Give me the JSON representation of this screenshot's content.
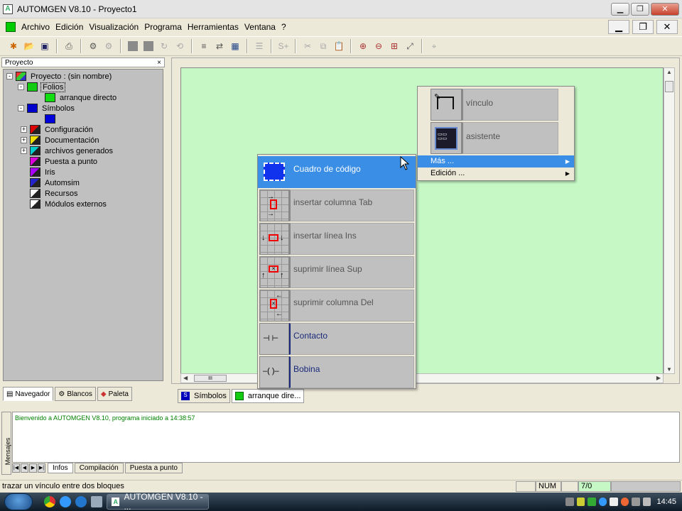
{
  "window": {
    "title": "AUTOMGEN V8.10 - Proyecto1",
    "min_label": "▁",
    "max_label": "❐",
    "close_label": "✕"
  },
  "menubar": {
    "items": [
      "Archivo",
      "Edición",
      "Visualización",
      "Programa",
      "Herramientas",
      "Ventana",
      "?"
    ],
    "mdi_min": "▁",
    "mdi_restore": "❐",
    "mdi_close": "✕"
  },
  "project_panel": {
    "title": "Proyecto",
    "close": "×",
    "tree": [
      {
        "label": "Proyecto : (sin nombre)",
        "level": 0,
        "expander": "-",
        "icon": "project-icon"
      },
      {
        "label": "Folios",
        "level": 1,
        "expander": "-",
        "icon": "folios-icon",
        "selected": true
      },
      {
        "label": "arranque directo",
        "level": 2,
        "expander": "",
        "icon": "sheet-icon"
      },
      {
        "label": "Símbolos",
        "level": 1,
        "expander": "-",
        "icon": "symbols-icon"
      },
      {
        "label": "",
        "level": 2,
        "expander": "",
        "icon": "symbol-sheet-icon"
      },
      {
        "label": "Configuración",
        "level": 1,
        "expander": "+",
        "icon": "config-icon"
      },
      {
        "label": "Documentación",
        "level": 1,
        "expander": "+",
        "icon": "docs-icon"
      },
      {
        "label": "archivos generados",
        "level": 1,
        "expander": "+",
        "icon": "generated-files-icon"
      },
      {
        "label": "Puesta a punto",
        "level": 1,
        "expander": "",
        "icon": "debug-icon"
      },
      {
        "label": "Iris",
        "level": 1,
        "expander": "",
        "icon": "iris-icon"
      },
      {
        "label": "Automsim",
        "level": 1,
        "expander": "",
        "icon": "automsim-icon"
      },
      {
        "label": "Recursos",
        "level": 1,
        "expander": "",
        "icon": "resources-icon"
      },
      {
        "label": "Módulos externos",
        "level": 1,
        "expander": "",
        "icon": "external-modules-icon"
      }
    ],
    "tabs": [
      "Navegador",
      "Blancos",
      "Paleta"
    ]
  },
  "document": {
    "tabs": [
      "Símbolos",
      "arranque dire..."
    ],
    "hscroll_thumb": "III",
    "canvas_color": "#c6f8c6"
  },
  "context_menu": {
    "items": [
      {
        "label": "Cuadro de código",
        "icon": "code-box-icon",
        "highlighted": true
      },
      {
        "label": "insertar columna Tab",
        "icon": "insert-column-icon"
      },
      {
        "label": "insertar línea Ins",
        "icon": "insert-line-icon"
      },
      {
        "label": "suprimir línea Sup",
        "icon": "delete-line-icon"
      },
      {
        "label": "suprimir columna Del",
        "icon": "delete-column-icon"
      },
      {
        "label": "Contacto",
        "icon": "contact-icon",
        "glyph": "⊣  ⊢"
      },
      {
        "label": "Bobina",
        "icon": "coil-icon",
        "glyph": "–( )–"
      }
    ]
  },
  "submenu": {
    "items": [
      {
        "label": "vínculo",
        "icon": "link-icon"
      },
      {
        "label": "asistente",
        "icon": "wizard-icon"
      }
    ],
    "mas": "Más ...",
    "edicion": "Edición ...",
    "arrow": "▶"
  },
  "messages": {
    "side_label": "Mensajes",
    "text": "Bienvenido a AUTOMGEN V8.10, programa iniciado a 14:38:57",
    "tabs": [
      "Infos",
      "Compilación",
      "Puesta a punto"
    ],
    "nav": [
      "|◀",
      "◀",
      "▶",
      "▶|"
    ]
  },
  "statusbar": {
    "text": "trazar un vínculo entre dos bloques",
    "num": "NUM",
    "counter": "7/0"
  },
  "taskbar": {
    "task": "AUTOMGEN V8.10 - ...",
    "time": "14:45"
  },
  "colors": {
    "highlight": "#3a8ee6",
    "canvas": "#c6f8c6",
    "tree_bg": "#c0c0c0"
  }
}
